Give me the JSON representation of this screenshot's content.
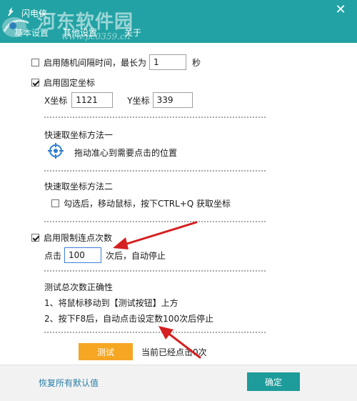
{
  "window": {
    "title": "闪电侠",
    "close_glyph": "✕"
  },
  "tabs": [
    {
      "label": "基本设置",
      "active": true
    },
    {
      "label": "其他设置",
      "active": false
    },
    {
      "label": "关于",
      "active": false
    }
  ],
  "watermark": {
    "text": "河东软件园",
    "url": "www.pc0359.cn"
  },
  "random_interval": {
    "checked": false,
    "label": "启用随机间隔时间，最长为",
    "value": "1",
    "unit": "秒"
  },
  "fixed_coords": {
    "checked": true,
    "label": "启用固定坐标",
    "x_label": "X坐标",
    "x_value": "1121",
    "y_label": "Y坐标",
    "y_value": "339"
  },
  "quick_method_1": {
    "title": "快速取坐标方法一",
    "icon": "crosshair-target-icon",
    "description": "拖动准心到需要点击的位置"
  },
  "quick_method_2": {
    "title": "快速取坐标方法二",
    "checked": false,
    "label": "勾选后，移动鼠标，按下CTRL+Q 获取坐标"
  },
  "click_limit": {
    "checked": true,
    "label": "启用限制连点次数",
    "prefix": "点击",
    "value": "100",
    "suffix": "次后，自动停止"
  },
  "test_section": {
    "title": "测试总次数正确性",
    "step1": "1、将鼠标移动到【测试按钮】上方",
    "step2": "2、按下F8后，自动点击设定数100次后停止",
    "button_label": "测试",
    "status_text": "当前已经点击0次"
  },
  "footer": {
    "reset_label": "恢复所有默认值",
    "ok_label": "确定"
  },
  "colors": {
    "titlebar": "#22a2a4",
    "ok_button": "#1e9b9b",
    "test_button": "#f5a623",
    "arrow": "#d42020"
  }
}
